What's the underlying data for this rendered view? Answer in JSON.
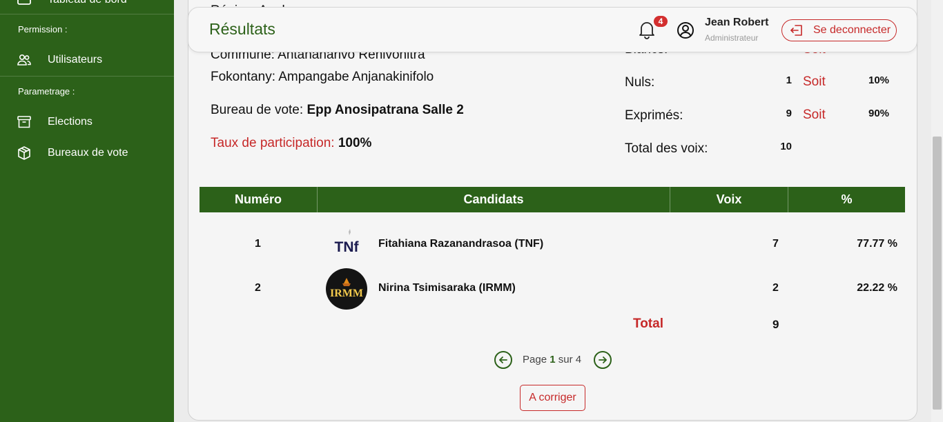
{
  "colors": {
    "primary": "#2c6119",
    "danger": "#c62828",
    "badge": "#d32f2f"
  },
  "sidebar": {
    "top_item": {
      "label": "Tableau de bord",
      "icon": "dashboard-icon"
    },
    "sections": [
      {
        "title": "Permission :",
        "items": [
          {
            "label": "Utilisateurs",
            "icon": "users-icon"
          }
        ]
      },
      {
        "title": "Parametrage :",
        "items": [
          {
            "label": "Elections",
            "icon": "archive-icon"
          },
          {
            "label": "Bureaux de vote",
            "icon": "box-icon"
          }
        ]
      }
    ]
  },
  "header": {
    "title": "Résultats",
    "notification_count": "4",
    "user_name": "Jean Robert",
    "user_role": "Administrateur",
    "logout_label": "Se deconnecter"
  },
  "info": {
    "region": "Région: Analamanga",
    "commune_label": "Commune:",
    "commune": "Antananarivo Renivohitra",
    "fokontany_label": "Fokontany:",
    "fokontany": "Ampangabe Anjanakinifolo",
    "bureau_label": "Bureau de vote:",
    "bureau": "Epp Anosipatrana Salle 2",
    "taux_label": "Taux de participation:",
    "taux": "100%"
  },
  "stats": {
    "blancs_label": "Blancs:",
    "soit_label": "Soit",
    "nuls_label": "Nuls:",
    "nuls_value": "1",
    "nuls_pct": "10%",
    "exprimes_label": "Exprimés:",
    "exprimes_value": "9",
    "exprimes_pct": "90%",
    "total_label": "Total des voix:",
    "total_value": "10"
  },
  "table": {
    "headers": [
      "Numéro",
      "Candidats",
      "Voix",
      "%"
    ],
    "rows": [
      {
        "numero": "1",
        "candidat": "Fitahiana Razanandrasoa (TNF)",
        "voix": "7",
        "pct": "77.77 %",
        "logo": "tnf-logo",
        "logo_text": "TNf"
      },
      {
        "numero": "2",
        "candidat": "Nirina Tsimisaraka (IRMM)",
        "voix": "2",
        "pct": "22.22 %",
        "logo": "irmm-logo",
        "logo_text": "IRMM"
      }
    ],
    "total_label": "Total",
    "total_value": "9"
  },
  "pagination": {
    "prefix": "Page",
    "current": "1",
    "middle": "sur",
    "total": "4"
  },
  "actions": {
    "corriger_label": "A corriger"
  }
}
